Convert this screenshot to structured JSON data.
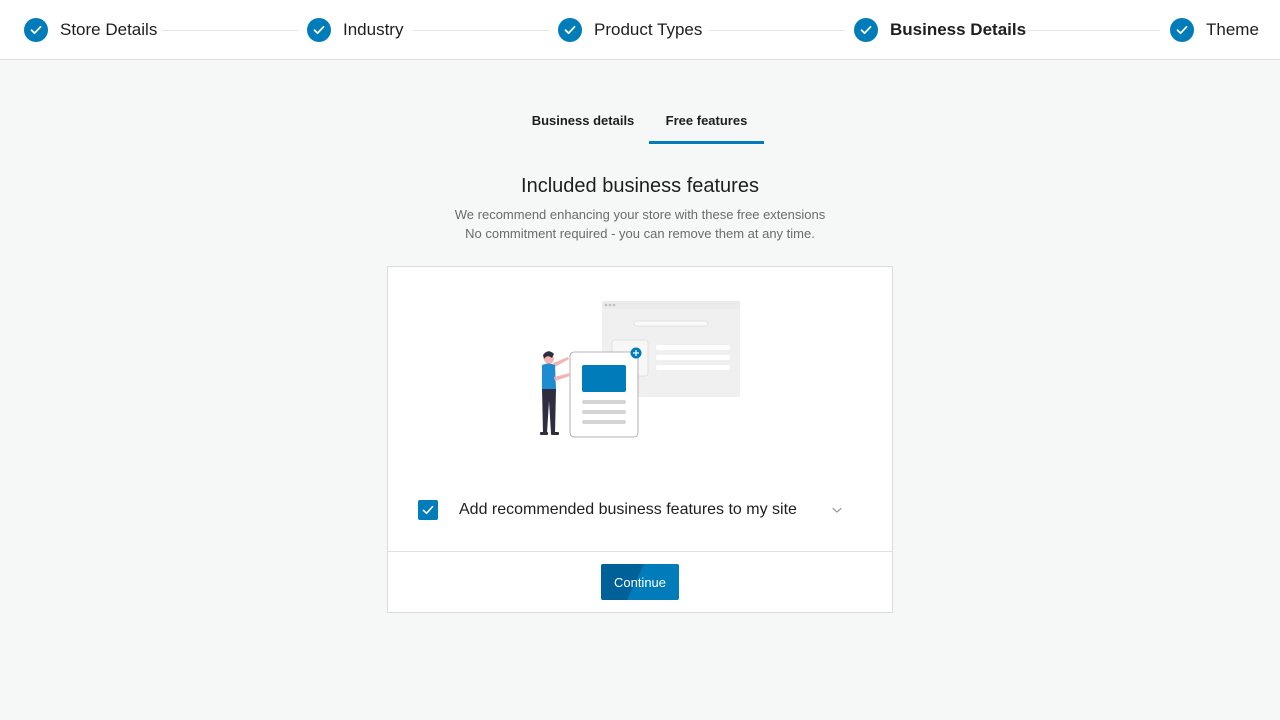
{
  "stepper": {
    "steps": [
      {
        "label": "Store Details",
        "state": "complete"
      },
      {
        "label": "Industry",
        "state": "complete"
      },
      {
        "label": "Product Types",
        "state": "complete"
      },
      {
        "label": "Business Details",
        "state": "current"
      },
      {
        "label": "Theme",
        "state": "complete"
      }
    ]
  },
  "tabs": [
    {
      "label": "Business details",
      "active": false
    },
    {
      "label": "Free features",
      "active": true
    }
  ],
  "heading": {
    "title": "Included business features",
    "line1": "We recommend enhancing your store with these free extensions",
    "line2": "No commitment required - you can remove them at any time."
  },
  "card": {
    "option_label": "Add recommended business features to my site",
    "option_checked": true,
    "continue_label": "Continue"
  },
  "colors": {
    "accent": "#007cba",
    "accent_dark": "#006098",
    "background": "#f6f7f7"
  }
}
